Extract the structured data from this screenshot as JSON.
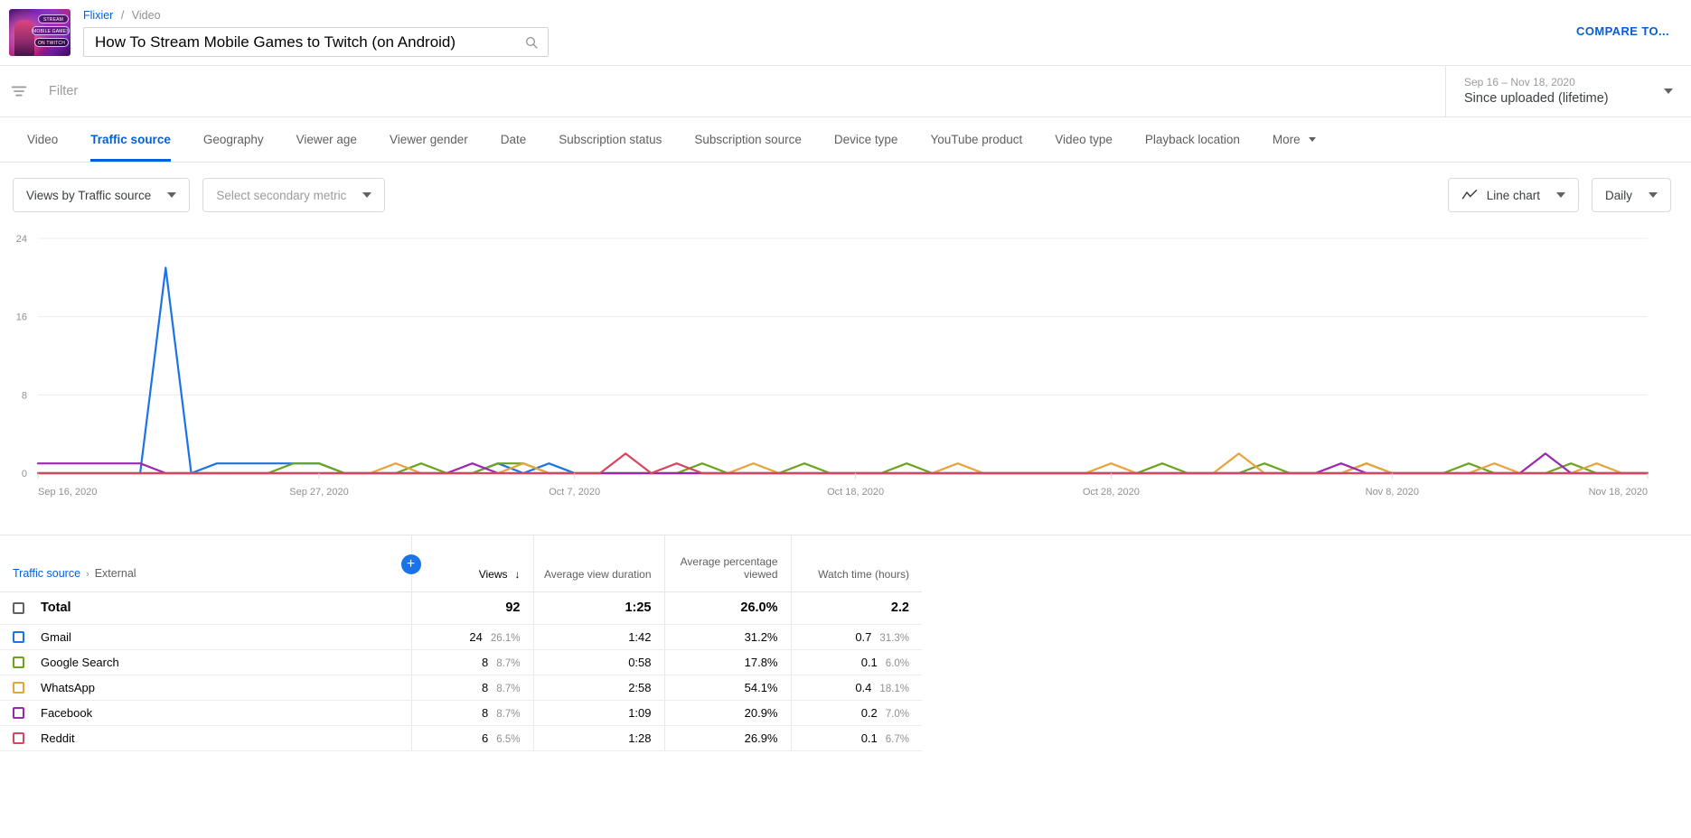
{
  "header": {
    "breadcrumb_link": "Flixier",
    "breadcrumb_sep": "/",
    "breadcrumb_current": "Video",
    "video_title": "How To Stream Mobile Games to Twitch (on Android)",
    "search_icon": "search-icon",
    "compare_to": "COMPARE TO...",
    "thumb_line1": "STREAM",
    "thumb_line2": "MOBILE GAMES",
    "thumb_line3": "ON TWITCH"
  },
  "filter_bar": {
    "filter_icon": "filter-icon",
    "filter_placeholder": "Filter",
    "date_range_top": "Sep 16 – Nov 18, 2020",
    "date_range_bottom": "Since uploaded (lifetime)",
    "caret_icon": "chevron-down-icon"
  },
  "tabs": [
    {
      "label": "Video",
      "active": false
    },
    {
      "label": "Traffic source",
      "active": true
    },
    {
      "label": "Geography",
      "active": false
    },
    {
      "label": "Viewer age",
      "active": false
    },
    {
      "label": "Viewer gender",
      "active": false
    },
    {
      "label": "Date",
      "active": false
    },
    {
      "label": "Subscription status",
      "active": false
    },
    {
      "label": "Subscription source",
      "active": false
    },
    {
      "label": "Device type",
      "active": false
    },
    {
      "label": "YouTube product",
      "active": false
    },
    {
      "label": "Video type",
      "active": false
    },
    {
      "label": "Playback location",
      "active": false
    },
    {
      "label": "More",
      "active": false
    }
  ],
  "controls": {
    "primary_metric": "Views by Traffic source",
    "secondary_metric_placeholder": "Select secondary metric",
    "chart_type": "Line chart",
    "chart_type_icon": "line-chart-icon",
    "granularity": "Daily",
    "caret_icon": "chevron-down-icon"
  },
  "table": {
    "breadcrumb_link": "Traffic source",
    "breadcrumb_sep": "›",
    "breadcrumb_current": "External",
    "add_metric_label": "+",
    "columns": [
      {
        "label": "Views",
        "sort": "↓"
      },
      {
        "label": "Average view duration"
      },
      {
        "label": "Average percentage viewed"
      },
      {
        "label": "Watch time (hours)"
      }
    ],
    "total_row": {
      "label": "Total",
      "views": "92",
      "avg_view_duration": "1:25",
      "avg_percentage_viewed": "26.0%",
      "watch_time": "2.2"
    },
    "rows": [
      {
        "label": "Gmail",
        "color": "#1a73e8",
        "views": "24",
        "views_pct": "26.1%",
        "avg_view_duration": "1:42",
        "avg_percentage_viewed": "31.2%",
        "watch_time": "0.7",
        "watch_pct": "31.3%"
      },
      {
        "label": "Google Search",
        "color": "#6aa41f",
        "views": "8",
        "views_pct": "8.7%",
        "avg_view_duration": "0:58",
        "avg_percentage_viewed": "17.8%",
        "watch_time": "0.1",
        "watch_pct": "6.0%"
      },
      {
        "label": "WhatsApp",
        "color": "#e8a33d",
        "views": "8",
        "views_pct": "8.7%",
        "avg_view_duration": "2:58",
        "avg_percentage_viewed": "54.1%",
        "watch_time": "0.4",
        "watch_pct": "18.1%"
      },
      {
        "label": "Facebook",
        "color": "#9c27b0",
        "views": "8",
        "views_pct": "8.7%",
        "avg_view_duration": "1:09",
        "avg_percentage_viewed": "20.9%",
        "watch_time": "0.2",
        "watch_pct": "7.0%"
      },
      {
        "label": "Reddit",
        "color": "#d9455f",
        "views": "6",
        "views_pct": "6.5%",
        "avg_view_duration": "1:28",
        "avg_percentage_viewed": "26.9%",
        "watch_time": "0.1",
        "watch_pct": "6.7%"
      }
    ]
  },
  "chart_data": {
    "type": "line",
    "title": "",
    "xlabel": "",
    "ylabel": "Views",
    "ylim": [
      0,
      24
    ],
    "yticks": [
      0,
      8,
      16,
      24
    ],
    "grid": true,
    "legend_position": "none",
    "xtick_labels": [
      "Sep 16, 2020",
      "Sep 27, 2020",
      "Oct 7, 2020",
      "Oct 18, 2020",
      "Oct 28, 2020",
      "Nov 8, 2020",
      "Nov 18, 2020"
    ],
    "xtick_indices": [
      0,
      11,
      21,
      32,
      42,
      53,
      63
    ],
    "x_count": 64,
    "series": [
      {
        "name": "Gmail",
        "color": "#1a73e8",
        "values": [
          0,
          0,
          0,
          0,
          0,
          21,
          0,
          1,
          1,
          1,
          1,
          1,
          0,
          0,
          0,
          0,
          0,
          0,
          1,
          0,
          1,
          0,
          0,
          0,
          0,
          0,
          0,
          0,
          0,
          0,
          0,
          0,
          0,
          0,
          0,
          0,
          0,
          0,
          0,
          0,
          0,
          0,
          0,
          0,
          0,
          0,
          0,
          0,
          0,
          0,
          0,
          0,
          0,
          0,
          0,
          0,
          0,
          0,
          0,
          0,
          0,
          0,
          0,
          0
        ]
      },
      {
        "name": "Google Search",
        "color": "#6aa41f",
        "values": [
          0,
          0,
          0,
          0,
          0,
          0,
          0,
          0,
          0,
          0,
          1,
          1,
          0,
          0,
          0,
          1,
          0,
          0,
          1,
          1,
          0,
          0,
          0,
          0,
          0,
          0,
          1,
          0,
          0,
          0,
          1,
          0,
          0,
          0,
          1,
          0,
          0,
          0,
          0,
          0,
          0,
          0,
          0,
          0,
          1,
          0,
          0,
          0,
          1,
          0,
          0,
          0,
          1,
          0,
          0,
          0,
          1,
          0,
          0,
          0,
          1,
          0,
          0,
          0
        ]
      },
      {
        "name": "WhatsApp",
        "color": "#e8a33d",
        "values": [
          0,
          0,
          0,
          0,
          0,
          0,
          0,
          0,
          0,
          0,
          0,
          0,
          0,
          0,
          1,
          0,
          0,
          0,
          0,
          1,
          0,
          0,
          0,
          0,
          0,
          0,
          0,
          0,
          1,
          0,
          0,
          0,
          0,
          0,
          0,
          0,
          1,
          0,
          0,
          0,
          0,
          0,
          1,
          0,
          0,
          0,
          0,
          2,
          0,
          0,
          0,
          0,
          1,
          0,
          0,
          0,
          0,
          1,
          0,
          0,
          0,
          1,
          0,
          0
        ]
      },
      {
        "name": "Facebook",
        "color": "#9c27b0",
        "values": [
          1,
          1,
          1,
          1,
          1,
          0,
          0,
          0,
          0,
          0,
          0,
          0,
          0,
          0,
          0,
          0,
          0,
          1,
          0,
          0,
          0,
          0,
          0,
          0,
          0,
          0,
          0,
          0,
          0,
          0,
          0,
          0,
          0,
          0,
          0,
          0,
          0,
          0,
          0,
          0,
          0,
          0,
          0,
          0,
          0,
          0,
          0,
          0,
          0,
          0,
          0,
          1,
          0,
          0,
          0,
          0,
          0,
          0,
          0,
          2,
          0,
          0,
          0,
          0
        ]
      },
      {
        "name": "Reddit",
        "color": "#d9455f",
        "values": [
          0,
          0,
          0,
          0,
          0,
          0,
          0,
          0,
          0,
          0,
          0,
          0,
          0,
          0,
          0,
          0,
          0,
          0,
          0,
          0,
          0,
          0,
          0,
          2,
          0,
          1,
          0,
          0,
          0,
          0,
          0,
          0,
          0,
          0,
          0,
          0,
          0,
          0,
          0,
          0,
          0,
          0,
          0,
          0,
          0,
          0,
          0,
          0,
          0,
          0,
          0,
          0,
          0,
          0,
          0,
          0,
          0,
          0,
          0,
          0,
          0,
          0,
          0,
          0
        ]
      }
    ]
  }
}
